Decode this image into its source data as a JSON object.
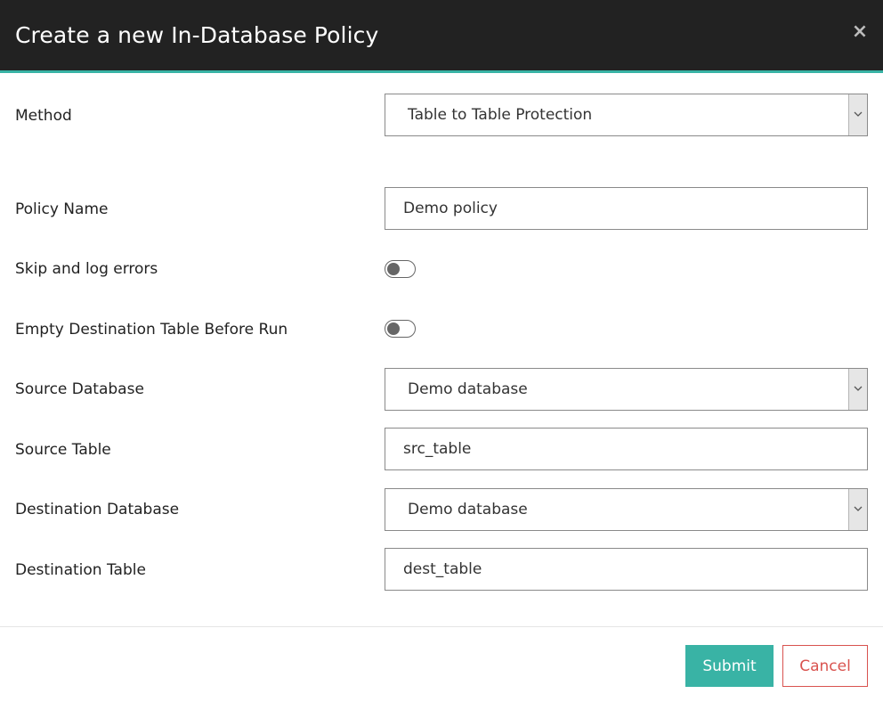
{
  "dialog": {
    "title": "Create a new In-Database Policy",
    "close_symbol": "×"
  },
  "form": {
    "method": {
      "label": "Method",
      "value": "Table to Table Protection"
    },
    "policy_name": {
      "label": "Policy Name",
      "value": "Demo policy"
    },
    "skip_log_errors": {
      "label": "Skip and log errors",
      "on": false
    },
    "empty_destination": {
      "label": "Empty Destination Table Before Run",
      "on": false
    },
    "source_database": {
      "label": "Source Database",
      "value": "Demo database"
    },
    "source_table": {
      "label": "Source Table",
      "value": "src_table"
    },
    "destination_database": {
      "label": "Destination Database",
      "value": "Demo database"
    },
    "destination_table": {
      "label": "Destination Table",
      "value": "dest_table"
    }
  },
  "footer": {
    "submit_label": "Submit",
    "cancel_label": "Cancel"
  },
  "colors": {
    "header_bg": "#222222",
    "accent": "#39b3a5",
    "danger": "#d9534f"
  },
  "icons": {
    "close": "close-icon",
    "dropdown": "chevron-down-icon"
  }
}
